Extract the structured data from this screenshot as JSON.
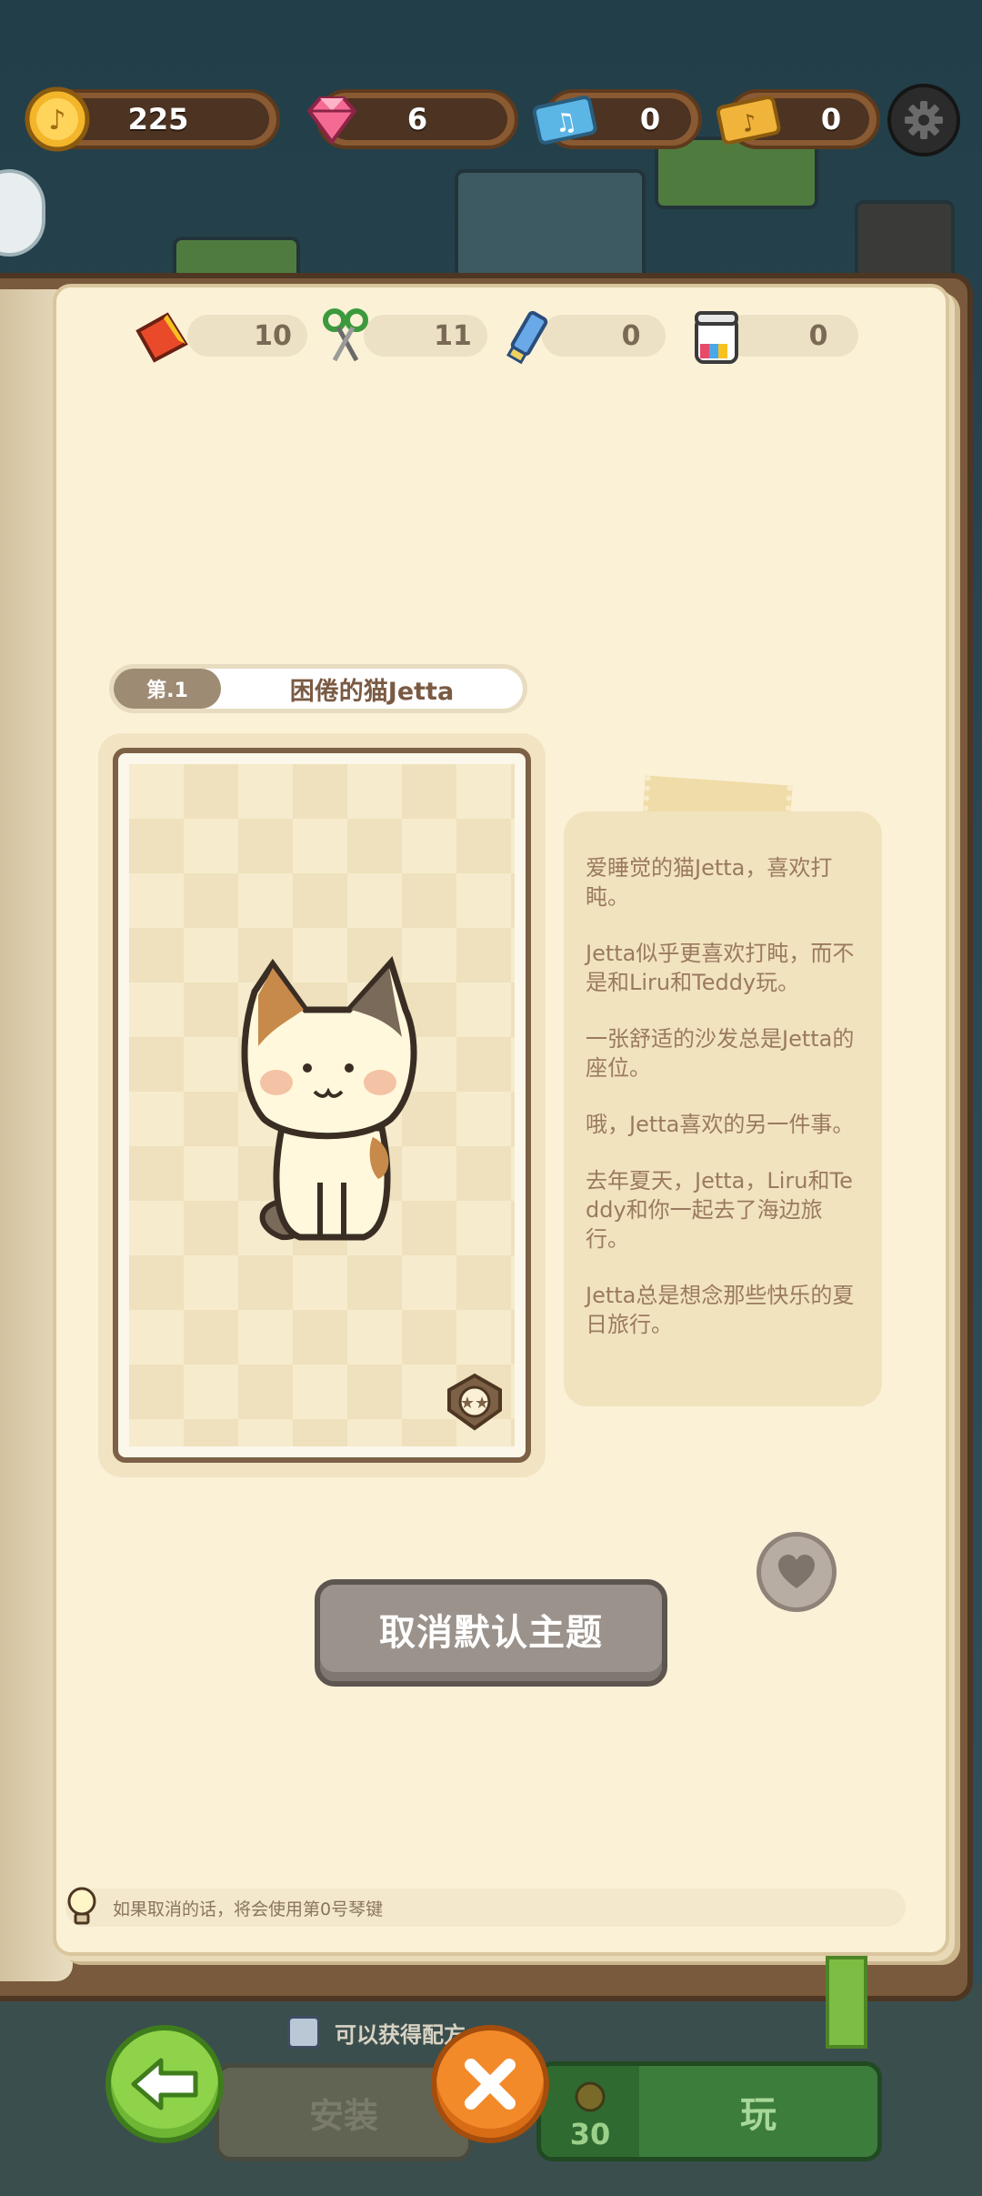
{
  "currencies": {
    "coins": "225",
    "gems": "6",
    "music_tickets": "0",
    "gold_tickets": "0"
  },
  "materials": {
    "paper": "10",
    "scissors": "11",
    "paint": "0",
    "glue": "0"
  },
  "theme": {
    "number_label": "第.1",
    "title": "困倦的猫Jetta",
    "description": [
      "爱睡觉的猫Jetta，喜欢打盹。",
      "Jetta似乎更喜欢打盹，而不是和Liru和Teddy玩。",
      "一张舒适的沙发总是Jetta的座位。",
      "哦，Jetta喜欢的另一件事。",
      "去年夏天，Jetta，Liru和Teddy和你一起去了海边旅行。",
      "Jetta总是想念那些快乐的夏日旅行。"
    ]
  },
  "actions": {
    "cancel_default_label": "取消默认主题"
  },
  "hint_text": "如果取消的话，将会使用第0号琴键",
  "background": {
    "recipe_hint": "可以获得配方",
    "install_label": "安装",
    "play_label": "玩",
    "play_cost": "30"
  },
  "colors": {
    "page": "#fbf1d7",
    "button_gray": "#9a928b",
    "back_green": "#8ed34a",
    "close_orange": "#f28a2a"
  }
}
